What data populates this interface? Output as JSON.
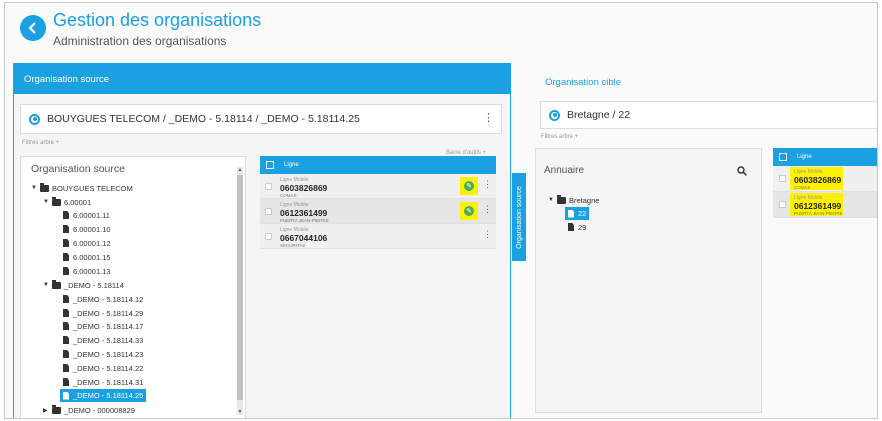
{
  "header": {
    "title": "Gestion des organisations",
    "subtitle": "Administration des organisations"
  },
  "source": {
    "panel_title": "Organisation source",
    "selected_org": "BOUYGUES TELECOM / _DEMO - 5.18114 / _DEMO - 5.18114.25",
    "tree_filters": "Filtres arbre +",
    "toolbar_link": "Barre d'outils +",
    "tree_title": "Organisation source",
    "tree": [
      {
        "label": "BOUYGUES TELECOM",
        "kind": "folder",
        "caret": "▼"
      },
      {
        "label": "6.00001",
        "kind": "folder",
        "caret": "▼"
      },
      {
        "label": "6.00001.11",
        "kind": "doc"
      },
      {
        "label": "6.00001.10",
        "kind": "doc"
      },
      {
        "label": "6.00001.12",
        "kind": "doc"
      },
      {
        "label": "6.00001.15",
        "kind": "doc"
      },
      {
        "label": "6.00001.13",
        "kind": "doc"
      },
      {
        "label": "_DEMO - 5.18114",
        "kind": "folder",
        "caret": "▼"
      },
      {
        "label": "_DEMO - 5.18114.12",
        "kind": "doc"
      },
      {
        "label": "_DEMO - 5.18114.29",
        "kind": "doc"
      },
      {
        "label": "_DEMO - 5.18114.17",
        "kind": "doc"
      },
      {
        "label": "_DEMO - 5.18114.33",
        "kind": "doc"
      },
      {
        "label": "_DEMO - 5.18114.23",
        "kind": "doc"
      },
      {
        "label": "_DEMO - 5.18114.22",
        "kind": "doc"
      },
      {
        "label": "_DEMO - 5.18114.31",
        "kind": "doc"
      },
      {
        "label": "_DEMO - 5.18114.25",
        "kind": "doc",
        "selected": true
      },
      {
        "label": "_DEMO - 000008829",
        "kind": "folder",
        "caret": "▶"
      }
    ],
    "list_header": "Ligne",
    "lines": [
      {
        "type": "Ligne Mobile",
        "number": "0603826869",
        "owner": "COMAS",
        "highlighted": true
      },
      {
        "type": "Ligne Mobile",
        "number": "0612361499",
        "owner": "PUERTA JEAN-PIERRE",
        "highlighted": true
      },
      {
        "type": "Ligne Mobile",
        "number": "0667044106",
        "owner": "SECURITAS",
        "highlighted": false
      }
    ]
  },
  "side_tab": "Organisation source",
  "target": {
    "panel_title": "Organisation cible",
    "selected_org": "Bretagne / 22",
    "tree_filters": "Filtres arbre +",
    "annuaire_title": "Annuaire",
    "tree": [
      {
        "label": "Bretagne",
        "kind": "folder",
        "caret": "▼"
      },
      {
        "label": "22",
        "kind": "doc",
        "selected": true
      },
      {
        "label": "29",
        "kind": "doc"
      }
    ],
    "list_header": "Ligne",
    "lines": [
      {
        "type": "Ligne Mobile",
        "number": "0603826869",
        "owner": "COMAS"
      },
      {
        "type": "Ligne Mobile",
        "number": "0612361499",
        "owner": "PUERTA JEAN-PIERRE"
      }
    ]
  },
  "colors": {
    "accent": "#1ba1e2",
    "highlight": "#fff200",
    "edit": "#4caf50"
  }
}
